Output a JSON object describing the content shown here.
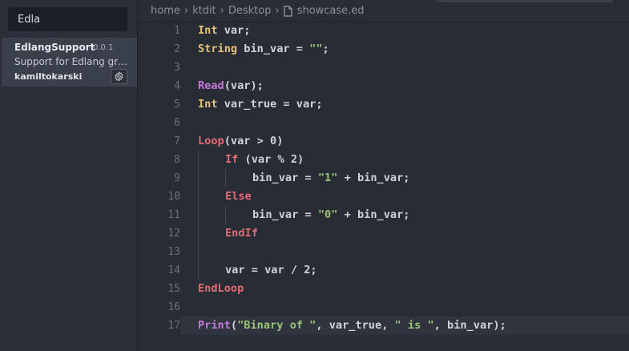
{
  "sidebar": {
    "search": {
      "value": "Edla"
    },
    "package": {
      "name": "EdlangSupport",
      "version": "0.0.1",
      "description": "Support for Edlang gr…",
      "author": "kamiltokarski",
      "settings_icon": "gear-icon"
    }
  },
  "breadcrumbs": {
    "items": [
      "home",
      "ktdit",
      "Desktop"
    ],
    "file": "showcase.ed",
    "file_icon": "file-icon",
    "separator_icon": "chevron-right-icon"
  },
  "editor": {
    "line_numbers": [
      "1",
      "2",
      "3",
      "4",
      "5",
      "6",
      "7",
      "8",
      "9",
      "10",
      "11",
      "12",
      "13",
      "14",
      "15",
      "16",
      "17"
    ],
    "current_line": 17,
    "lines": [
      {
        "n": 1,
        "indent": 0,
        "tokens": [
          {
            "t": "Int",
            "c": "kw-type"
          },
          {
            "t": " var;",
            "c": "plain"
          }
        ]
      },
      {
        "n": 2,
        "indent": 0,
        "tokens": [
          {
            "t": "String",
            "c": "kw-type"
          },
          {
            "t": " bin_var = ",
            "c": "plain"
          },
          {
            "t": "\"\"",
            "c": "str"
          },
          {
            "t": ";",
            "c": "plain"
          }
        ]
      },
      {
        "n": 3,
        "indent": 0,
        "tokens": []
      },
      {
        "n": 4,
        "indent": 0,
        "tokens": [
          {
            "t": "Read",
            "c": "kw-func"
          },
          {
            "t": "(var);",
            "c": "plain"
          }
        ]
      },
      {
        "n": 5,
        "indent": 0,
        "tokens": [
          {
            "t": "Int",
            "c": "kw-type"
          },
          {
            "t": " var_true = var;",
            "c": "plain"
          }
        ]
      },
      {
        "n": 6,
        "indent": 0,
        "tokens": []
      },
      {
        "n": 7,
        "indent": 0,
        "tokens": [
          {
            "t": "Loop",
            "c": "kw-ctrl"
          },
          {
            "t": "(var > 0)",
            "c": "plain"
          }
        ]
      },
      {
        "n": 8,
        "indent": 1,
        "tokens": [
          {
            "t": "If",
            "c": "kw-ctrl"
          },
          {
            "t": " (var % 2)",
            "c": "plain"
          }
        ]
      },
      {
        "n": 9,
        "indent": 2,
        "tokens": [
          {
            "t": "bin_var = ",
            "c": "plain"
          },
          {
            "t": "\"1\"",
            "c": "str"
          },
          {
            "t": " + bin_var;",
            "c": "plain"
          }
        ]
      },
      {
        "n": 10,
        "indent": 1,
        "tokens": [
          {
            "t": "Else",
            "c": "kw-ctrl"
          }
        ]
      },
      {
        "n": 11,
        "indent": 2,
        "tokens": [
          {
            "t": "bin_var = ",
            "c": "plain"
          },
          {
            "t": "\"0\"",
            "c": "str"
          },
          {
            "t": " + bin_var;",
            "c": "plain"
          }
        ]
      },
      {
        "n": 12,
        "indent": 1,
        "tokens": [
          {
            "t": "EndIf",
            "c": "kw-ctrl"
          }
        ]
      },
      {
        "n": 13,
        "indent": 0,
        "tokens": []
      },
      {
        "n": 14,
        "indent": 1,
        "tokens": [
          {
            "t": "var = var / 2;",
            "c": "plain"
          }
        ]
      },
      {
        "n": 15,
        "indent": 0,
        "tokens": [
          {
            "t": "EndLoop",
            "c": "kw-ctrl"
          }
        ]
      },
      {
        "n": 16,
        "indent": 0,
        "tokens": []
      },
      {
        "n": 17,
        "indent": 0,
        "tokens": [
          {
            "t": "Print",
            "c": "kw-func"
          },
          {
            "t": "(",
            "c": "plain"
          },
          {
            "t": "\"Binary of \"",
            "c": "str"
          },
          {
            "t": ", var_true, ",
            "c": "plain"
          },
          {
            "t": "\" is \"",
            "c": "str"
          },
          {
            "t": ", bin_var);",
            "c": "plain"
          }
        ]
      }
    ]
  },
  "colors": {
    "background": "#272c35",
    "sidebar": "#2b3038",
    "type_keyword": "#e5c07b",
    "function_keyword": "#c678dd",
    "control_keyword": "#e06c75",
    "string": "#98c379"
  }
}
